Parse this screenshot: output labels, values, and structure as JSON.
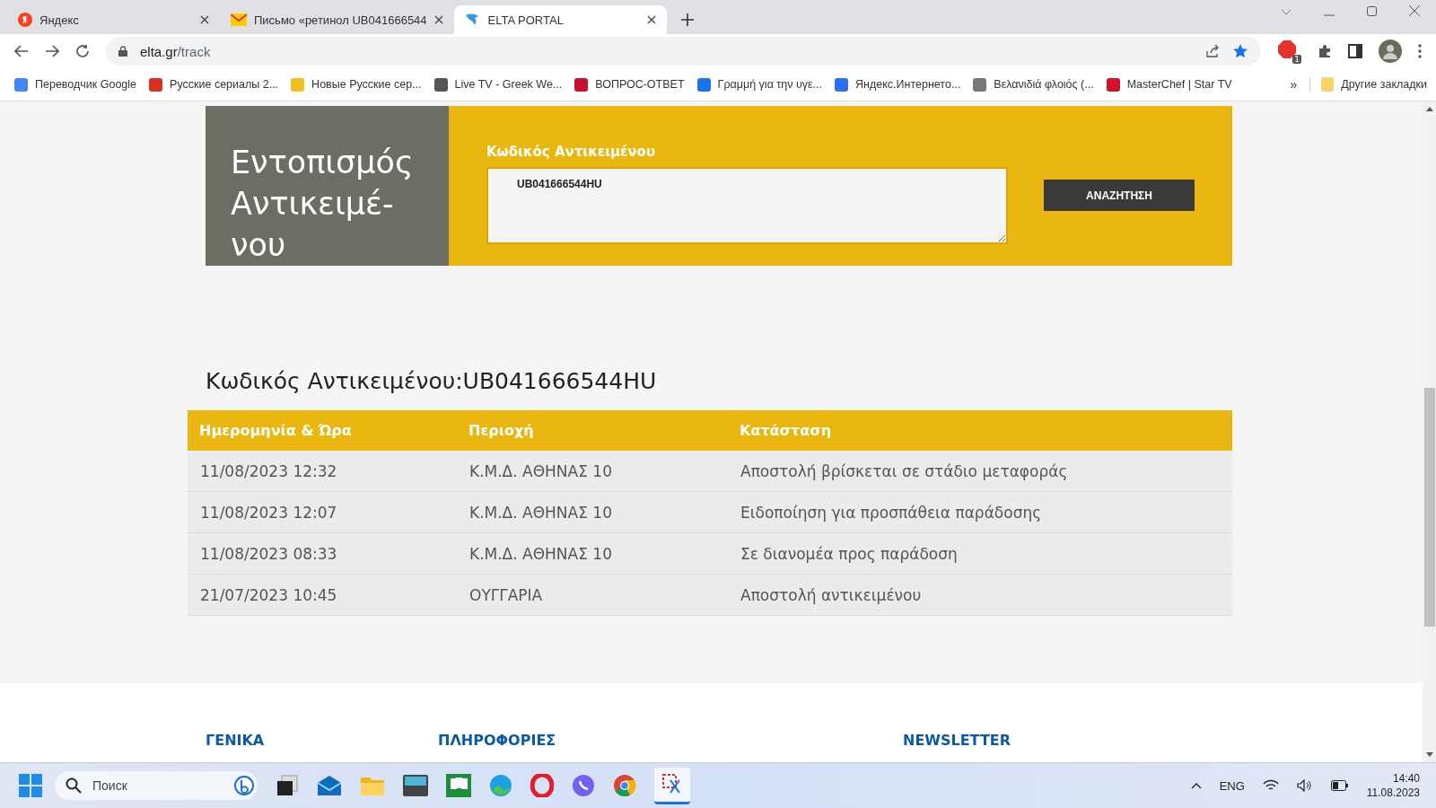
{
  "browser": {
    "tabs": [
      {
        "title": "Яндекс",
        "selected": false
      },
      {
        "title": "Письмо «ретинол UB041666544",
        "selected": false
      },
      {
        "title": "ELTA PORTAL",
        "selected": true
      }
    ],
    "url": {
      "host": "elta.gr",
      "path": "/track"
    },
    "extension_badge": "1",
    "bookmarks": [
      {
        "label": "Переводчик Google",
        "color": "#4285f4"
      },
      {
        "label": "Русские сериалы 2...",
        "color": "#d93025"
      },
      {
        "label": "Новые Русские сер...",
        "color": "#f2c01e"
      },
      {
        "label": "Live TV - Greek We...",
        "color": "#555555"
      },
      {
        "label": "ВОПРОС-ОТВЕТ",
        "color": "#c8102e"
      },
      {
        "label": "Γραμμή για την υγε...",
        "color": "#1a73e8"
      },
      {
        "label": "Яндекс.Интернето...",
        "color": "#2f6df6"
      },
      {
        "label": "Βελανιδιά φλοιός (...",
        "color": "#777777"
      },
      {
        "label": "MasterChef | Star TV",
        "color": "#d3112c"
      }
    ],
    "bookmarks_more": "»",
    "other_bookmarks": "Другие закладки"
  },
  "search_panel": {
    "title_lines": [
      "Εντοπισμός",
      "Αντικειμέ-",
      "νου"
    ],
    "field_label": "Κωδικός Αντικειμένου",
    "field_value": "UB041666544HU",
    "button": "ΑΝΑΖΗΤΗΣΗ"
  },
  "result": {
    "heading": "Κωδικός Αντικειμένου:UB041666544HU",
    "columns": [
      "Ημερομηνία & Ώρα",
      "Περιοχή",
      "Κατάσταση"
    ],
    "rows": [
      [
        "11/08/2023 12:32",
        "Κ.Μ.Δ. ΑΘΗΝΑΣ 10",
        "Αποστολή βρίσκεται σε στάδιο μεταφοράς"
      ],
      [
        "11/08/2023 12:07",
        "Κ.Μ.Δ. ΑΘΗΝΑΣ 10",
        "Ειδοποίηση για προσπάθεια παράδοσης"
      ],
      [
        "11/08/2023 08:33",
        "Κ.Μ.Δ. ΑΘΗΝΑΣ 10",
        "Σε διανομέα προς παράδοση"
      ],
      [
        "21/07/2023 10:45",
        "ΟΥΓΓΑΡΙΑ",
        "Αποστολή αντικειμένου"
      ]
    ]
  },
  "footer": {
    "headings": [
      "ΓΕΝΙΚΑ",
      "ΠΛΗΡΟΦΟΡΙΕΣ",
      "NEWSLETTER"
    ]
  },
  "taskbar": {
    "search_placeholder": "Поиск",
    "language": "ENG",
    "time": "14:40",
    "date": "11.08.2023"
  }
}
